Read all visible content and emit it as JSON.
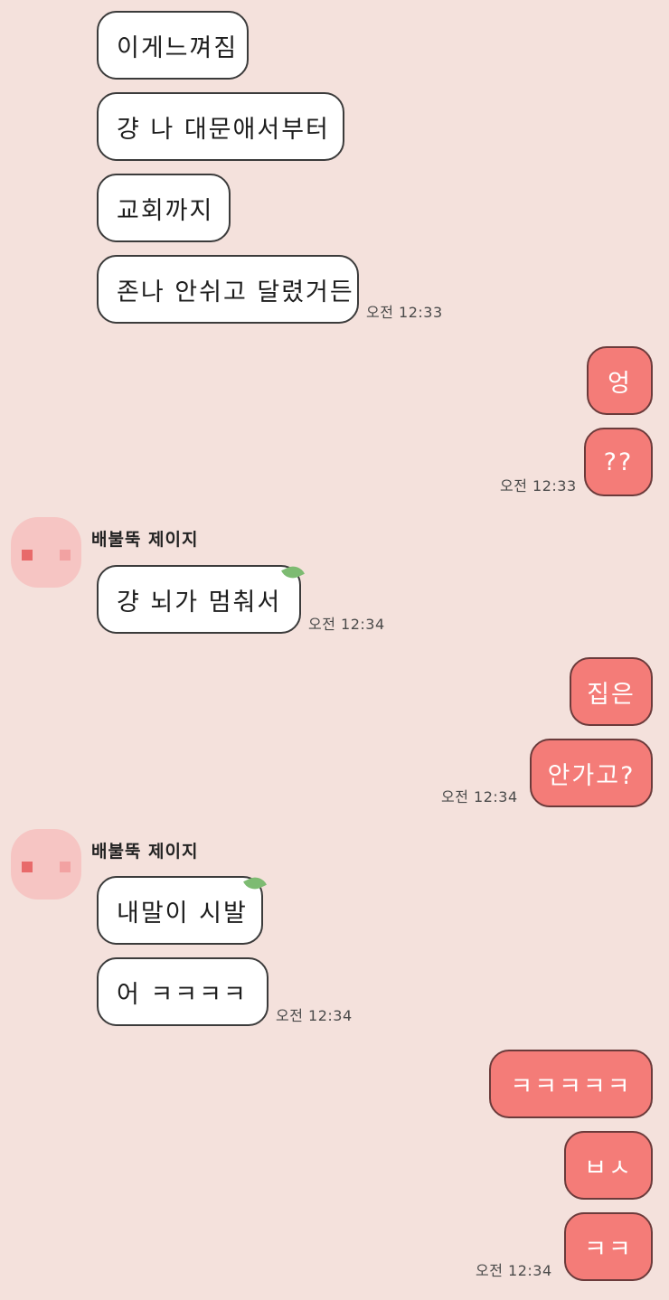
{
  "colors": {
    "background": "#f4e1dc",
    "incoming_bubble": "#ffffff",
    "outgoing_bubble": "#f47c78",
    "avatar": "#f6c5c3"
  },
  "messages": {
    "m1": "이게느껴짐",
    "m2": "걍 나 대문애서부터",
    "m3": "교회까지",
    "m4": "존나 안쉬고 달렸거든",
    "t1": "오전 12:33",
    "m5": "엉",
    "m6": "??",
    "t2": "오전 12:33",
    "sender1": "배불뚝 제이지",
    "m7": "걍 뇌가 멈춰서",
    "t3": "오전 12:34",
    "m8": "집은",
    "m9": "안가고?",
    "t4": "오전 12:34",
    "sender2": "배불뚝 제이지",
    "m10": "내말이 시발",
    "m11": "어 ㅋㅋㅋㅋ",
    "t5": "오전 12:34",
    "m12": "ㅋㅋㅋㅋㅋ",
    "m13": "ㅂㅅ",
    "m14": "ㅋㅋ",
    "t6": "오전 12:34"
  }
}
